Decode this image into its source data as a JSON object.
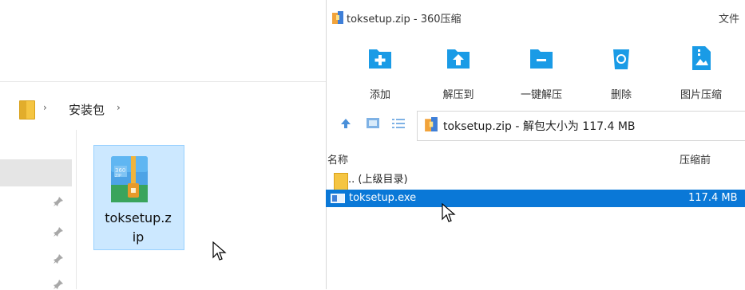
{
  "explorer": {
    "breadcrumb": {
      "separator": "›",
      "folder_label": "安装包"
    },
    "file": {
      "name_line1": "toksetup.z",
      "name_line2": "ip"
    }
  },
  "zip_window": {
    "title": "toksetup.zip - 360压缩",
    "menu_file": "文件",
    "toolbar": {
      "add": "添加",
      "extract_to": "解压到",
      "one_click_extract": "一键解压",
      "delete": "删除",
      "image_compress": "图片压缩"
    },
    "path_text": "toksetup.zip - 解包大小为 117.4 MB",
    "columns": {
      "name": "名称",
      "size_before": "压缩前"
    },
    "rows": [
      {
        "name": ".. (上级目录)",
        "size": ""
      },
      {
        "name": "toksetup.exe",
        "size": "117.4 MB"
      }
    ],
    "selected_row_color": "#0a78d7",
    "accent_color": "#1a9be6"
  }
}
